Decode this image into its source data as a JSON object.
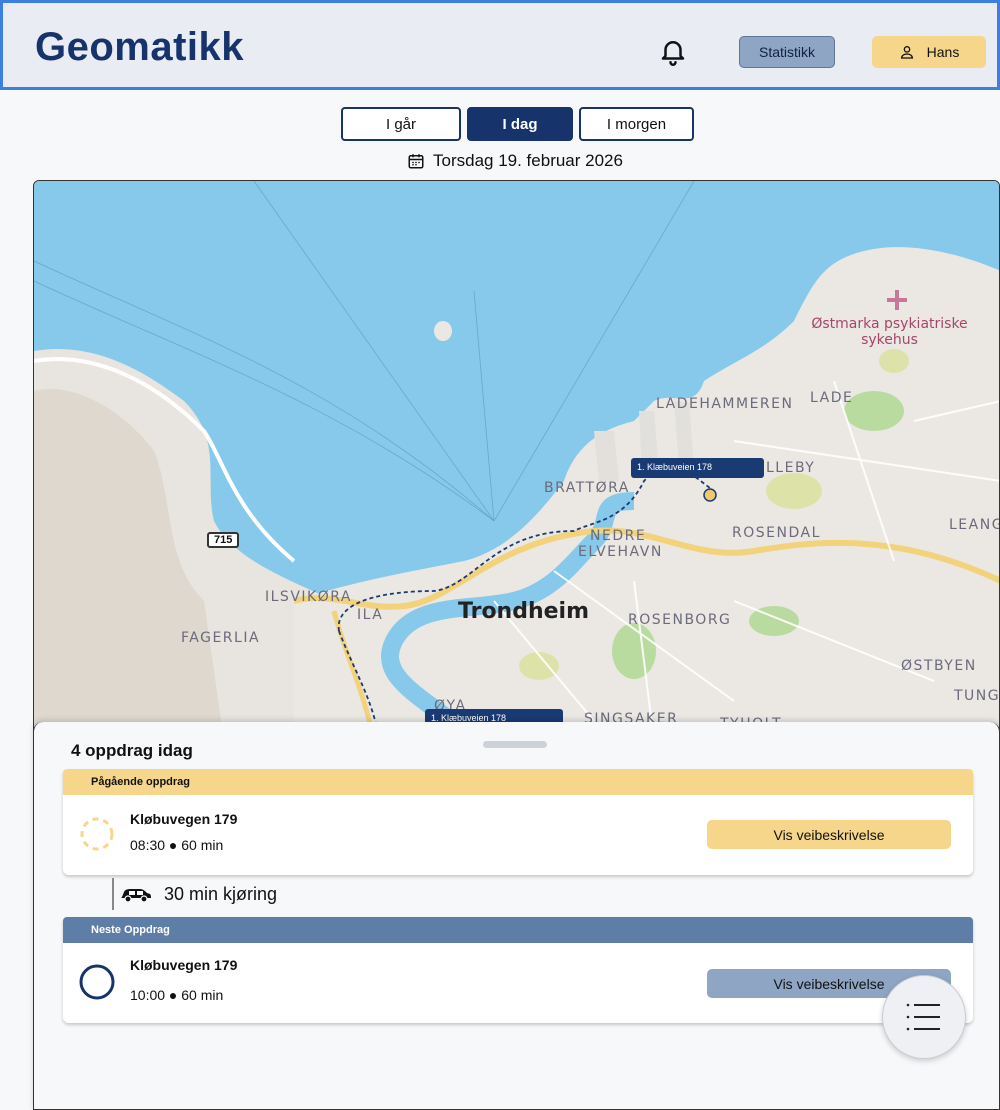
{
  "header": {
    "logo": "Geomatikk",
    "stats_label": "Statistikk",
    "user_label": "Hans"
  },
  "day_tabs": {
    "yesterday": "I går",
    "today": "I dag",
    "tomorrow": "I morgen"
  },
  "date_label": "Torsdag 19. februar 2026",
  "map": {
    "labels": {
      "trondheim": "Trondheim",
      "hospital_line1": "Østmarka psykiatriske",
      "hospital_line2": "sykehus",
      "ladehammeren": "LADEHAMMEREN",
      "lade": "LADE",
      "lleby": "LLEBY",
      "brattora": "BRATTØRA",
      "nedre1": "NEDRE",
      "nedre2": "ELVEHAVN",
      "rosendal": "ROSENDAL",
      "leang": "LEANG",
      "ilsvikora": "ILSVIKØRA",
      "ila": "ILA",
      "fagerlia": "FAGERLIA",
      "rosenborg": "ROSENBORG",
      "ostbyen": "ØSTBYEN",
      "tung": "TUNG",
      "oya": "ØYA",
      "singsaker": "SINGSAKER",
      "tyholt": "TYHOLT",
      "road": "715"
    },
    "pins": {
      "pin1": "1. Klæbuveien 178",
      "pin2": "1. Klæbuveien 178"
    }
  },
  "sheet": {
    "title": "4 oppdrag idag",
    "current": {
      "header": "Pågående oppdrag",
      "address": "Kløbuvegen 179",
      "time": "08:30 ● 60 min",
      "button": "Vis veibeskrivelse"
    },
    "drive": "30 min kjøring",
    "next": {
      "header": "Neste Oppdrag",
      "address": "Kløbuvegen 179",
      "time": "10:00 ● 60 min",
      "button": "Vis veibeskrivelse"
    }
  },
  "colors": {
    "brand": "#16336b",
    "accent_yellow": "#f6d68a",
    "next_header": "#5f7ea7",
    "next_button": "#8fa5c4",
    "water": "#86c9ea"
  },
  "icons": {
    "bell": "bell-icon",
    "user": "user-icon",
    "calendar": "calendar-icon",
    "car": "car-icon",
    "menu": "menu-icon"
  }
}
